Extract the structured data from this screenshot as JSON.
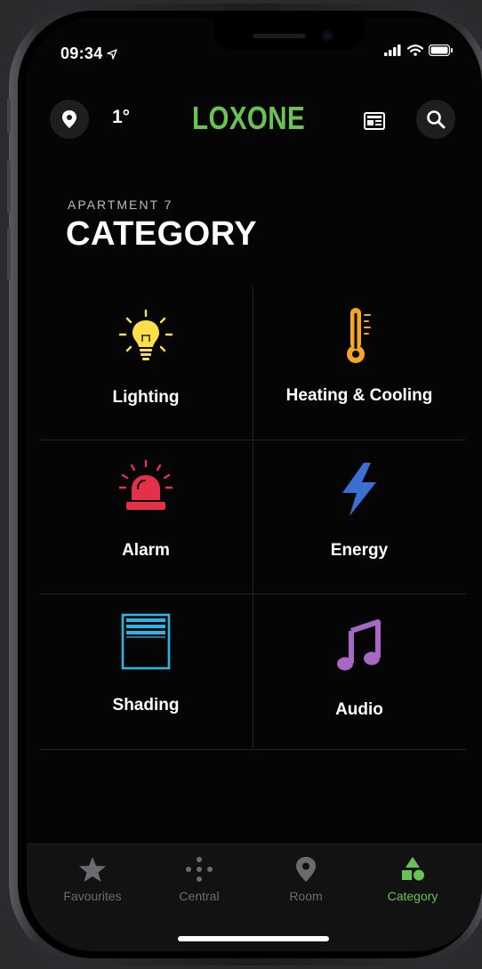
{
  "status": {
    "time": "09:34"
  },
  "header": {
    "temperature": "1°",
    "logo": "LOXONE"
  },
  "page": {
    "subtitle": "APARTMENT 7",
    "title": "CATEGORY"
  },
  "categories": [
    {
      "label": "Lighting",
      "icon": "lightbulb-icon",
      "color": "#fde047"
    },
    {
      "label": "Heating & Cooling",
      "icon": "thermometer-icon",
      "color": "#f6a623"
    },
    {
      "label": "Alarm",
      "icon": "alarm-siren-icon",
      "color": "#e5304a"
    },
    {
      "label": "Energy",
      "icon": "lightning-bolt-icon",
      "color": "#3b6fd4"
    },
    {
      "label": "Shading",
      "icon": "blinds-icon",
      "color": "#27b6e6"
    },
    {
      "label": "Audio",
      "icon": "music-note-icon",
      "color": "#a767c5"
    }
  ],
  "tabs": [
    {
      "label": "Favourites",
      "icon": "star-icon"
    },
    {
      "label": "Central",
      "icon": "dots-icon"
    },
    {
      "label": "Room",
      "icon": "location-pin-icon"
    },
    {
      "label": "Category",
      "icon": "shapes-icon",
      "active": true
    }
  ],
  "colors": {
    "accent": "#69c350",
    "background": "#050505"
  }
}
